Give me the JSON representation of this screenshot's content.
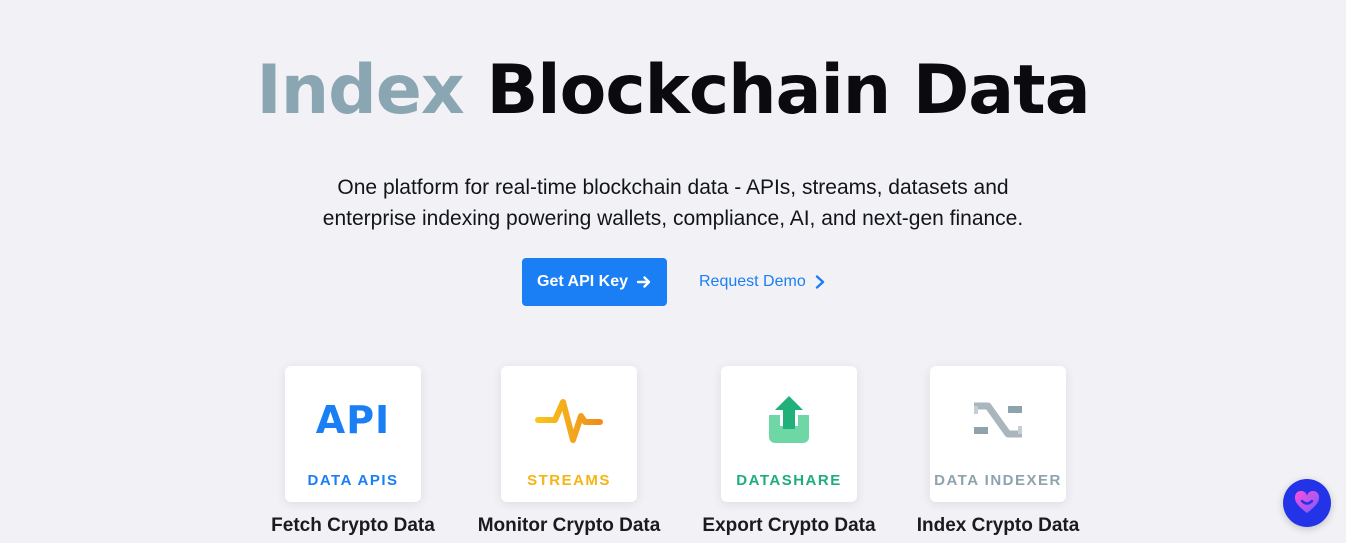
{
  "hero": {
    "title_accent": "Index",
    "title_rest": "Blockchain Data",
    "subtitle_line1": "One platform for real-time blockchain data - APIs, streams, datasets and",
    "subtitle_line2": "enterprise indexing powering wallets, compliance, AI, and next-gen finance."
  },
  "cta": {
    "primary_label": "Get API Key",
    "primary_icon": "arrow-right-icon",
    "secondary_label": "Request Demo",
    "secondary_icon": "chevron-right-icon"
  },
  "products": [
    {
      "label": "DATA APIS",
      "caption": "Fetch Crypto Data",
      "icon": "api-icon",
      "color": "#1a7ef5",
      "icon_text": "API"
    },
    {
      "label": "STREAMS",
      "caption": "Monitor Crypto Data",
      "icon": "pulse-icon",
      "color": "#f5b514"
    },
    {
      "label": "DATASHARE",
      "caption": "Export Crypto Data",
      "icon": "upload-icon",
      "color": "#1fae79"
    },
    {
      "label": "DATA INDEXER",
      "caption": "Index Crypto Data",
      "icon": "indexer-icon",
      "color": "#8ea3ad"
    }
  ],
  "colors": {
    "accent": "#1a7ef5",
    "title_accent": "#8aa6b2",
    "background": "#f2f2f6",
    "chat": "#2334e8"
  },
  "chat": {
    "icon": "heart-chat-icon"
  }
}
